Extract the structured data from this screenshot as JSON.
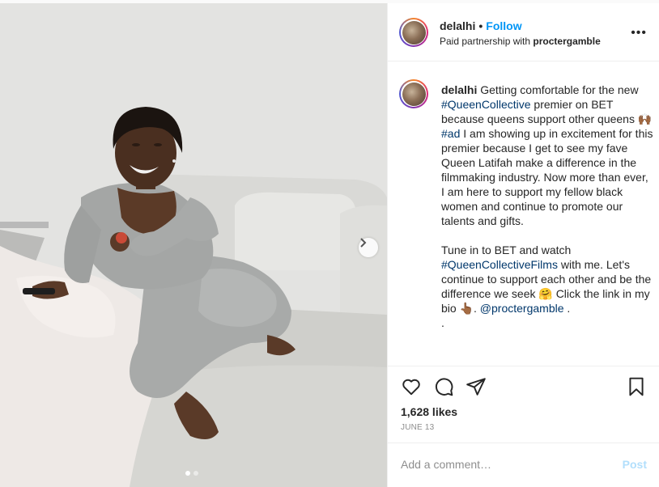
{
  "post": {
    "username": "delalhi",
    "separator": "•",
    "follow_label": "Follow",
    "partnership_prefix": "Paid partnership with",
    "partner": "proctergamble",
    "more_label": "•••"
  },
  "caption": {
    "username": "delalhi",
    "t1": " Getting comfortable for the new ",
    "tag1": "#QueenCollective",
    "t2": " premier on BET because queens support other queens 🙌🏾 ",
    "tag2": "#ad",
    "t3": " I am showing up in excitement for this premier because I get to see my fave Queen Latifah make a difference in the filmmaking industry. Now more than ever, I am here to support my fellow black women and continue to promote our talents and gifts.",
    "p2_t1": "Tune in to BET and watch ",
    "tag3": "#QueenCollectiveFilms",
    "p2_t2": " with me. Let's continue to support each other and be the difference we seek 🤗 Click the link in my bio 👆🏾. ",
    "mention": "@proctergamble",
    "p2_t3": " .",
    "p3": "."
  },
  "stats": {
    "likes": "1,628 likes",
    "date": "JUNE 13"
  },
  "comment": {
    "placeholder": "Add a comment…",
    "post_label": "Post"
  },
  "icons": {
    "like": "heart-icon",
    "comment": "comment-icon",
    "share": "paper-plane-icon",
    "save": "bookmark-icon",
    "next": "chevron-right-icon"
  },
  "colors": {
    "link": "#0095f6",
    "hashtag": "#00376b",
    "post_disabled": "#b2dffc",
    "muted": "#8e8e8e"
  },
  "carousel": {
    "count": 2,
    "active": 1
  }
}
